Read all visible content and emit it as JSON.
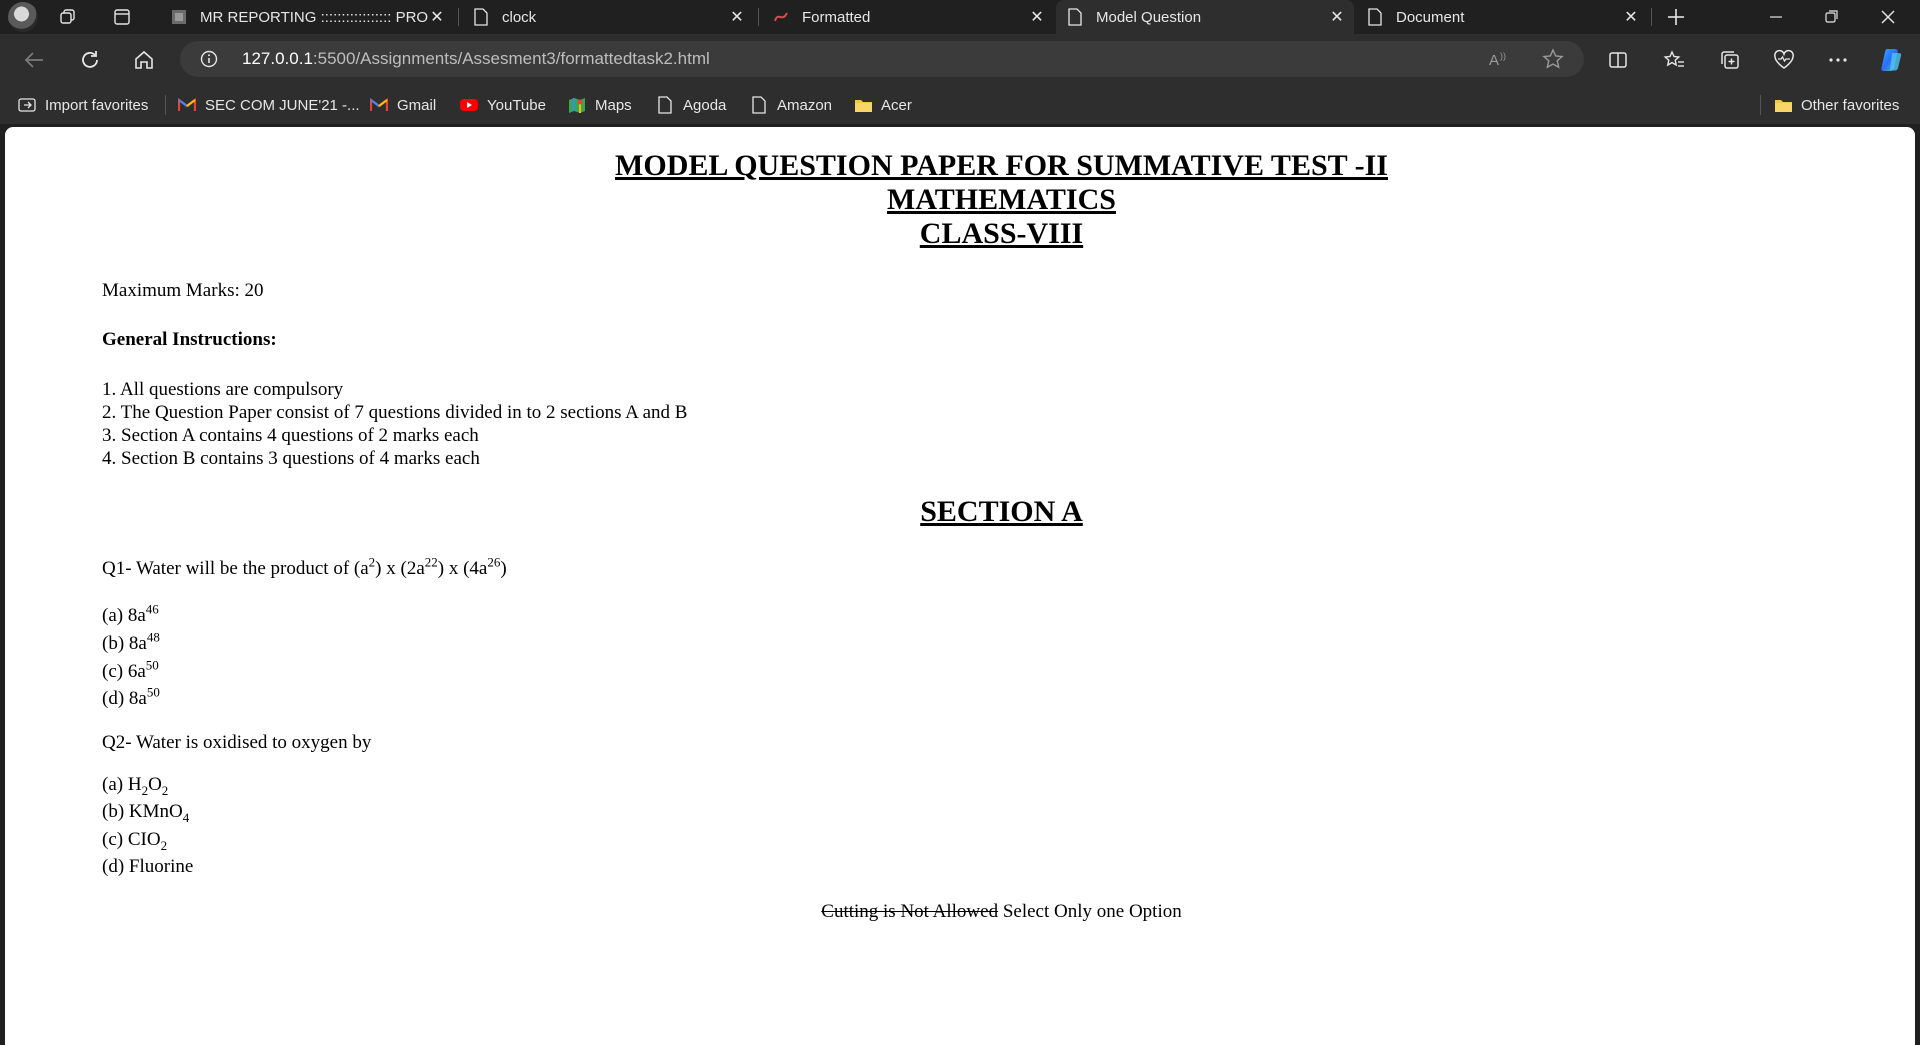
{
  "browser": {
    "tabs": [
      {
        "title": "MR REPORTING ::::::::::::::::: PROCE",
        "active": false
      },
      {
        "title": "clock",
        "active": false
      },
      {
        "title": "Formatted",
        "active": false
      },
      {
        "title": "Model Question",
        "active": true
      },
      {
        "title": "Document",
        "active": false
      }
    ],
    "address": {
      "host": "127.0.0.1",
      "path": ":5500/Assignments/Assesment3/formattedtask2.html"
    },
    "bookmarks": [
      {
        "label": "Import favorites",
        "icon": "import-icon"
      },
      {
        "label": "SEC COM JUNE'21 -...",
        "icon": "gmail-icon"
      },
      {
        "label": "Gmail",
        "icon": "gmail-icon"
      },
      {
        "label": "YouTube",
        "icon": "youtube-icon"
      },
      {
        "label": "Maps",
        "icon": "maps-icon"
      },
      {
        "label": "Agoda",
        "icon": "page-icon"
      },
      {
        "label": "Amazon",
        "icon": "page-icon"
      },
      {
        "label": "Acer",
        "icon": "folder-icon"
      },
      {
        "label": "Other favorites",
        "icon": "folder-icon"
      }
    ]
  },
  "page": {
    "title_lines": [
      "MODEL QUESTION PAPER FOR SUMMATIVE TEST -II",
      "MATHEMATICS",
      "CLASS-VIII"
    ],
    "max_marks": "Maximum Marks: 20",
    "instructions_heading": "General Instructions:",
    "instructions": [
      "1. All questions are compulsory",
      "2. The Question Paper consist of 7 questions divided in to 2 sections A and B",
      "3. Section A contains 4 questions of 2 marks each",
      "4. Section B contains 3 questions of 4 marks each"
    ],
    "section_title": "SECTION A",
    "q1": {
      "prefix": "Q1- Water will be the product of (a",
      "exp1": "2",
      "mid1": ") x (2a",
      "exp2": "22",
      "mid2": ") x (4a",
      "exp3": "26",
      "suffix": ")",
      "options": [
        {
          "base": "(a) 8a",
          "exp": "46"
        },
        {
          "base": "(b) 8a",
          "exp": "48"
        },
        {
          "base": "(c) 6a",
          "exp": "50"
        },
        {
          "base": "(d) 8a",
          "exp": "50"
        }
      ]
    },
    "q2": {
      "text": "Q2- Water is oxidised to oxygen by",
      "opt_a": {
        "p1": "(a) H",
        "s1": "2",
        "p2": "O",
        "s2": "2"
      },
      "opt_b": {
        "p1": "(b) KMnO",
        "s1": "4"
      },
      "opt_c": {
        "p1": "(c) CIO",
        "s1": "2"
      },
      "opt_d": "(d) Fluorine"
    },
    "note": {
      "struck": "Cutting is Not Allowed",
      "rest": " Select Only one Option"
    }
  }
}
